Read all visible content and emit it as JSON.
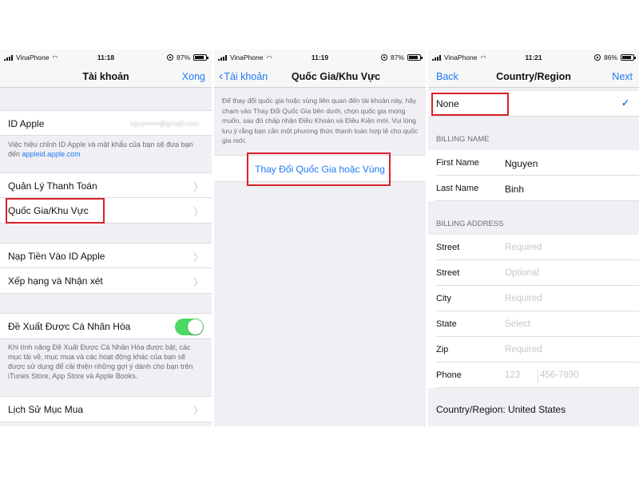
{
  "status_bars": [
    {
      "carrier": "VinaPhone",
      "time": "11:18",
      "battery": "87%",
      "battery_level": 0.87
    },
    {
      "carrier": "VinaPhone",
      "time": "11:19",
      "battery": "87%",
      "battery_level": 0.87
    },
    {
      "carrier": "VinaPhone",
      "time": "11:21",
      "battery": "86%",
      "battery_level": 0.86
    }
  ],
  "screen1": {
    "title": "Tài khoản",
    "done": "Xong",
    "apple_id_label": "ID Apple",
    "apple_id_value": "tqcu••••••@gmail.com",
    "apple_id_footer": "Việc hiệu chỉnh ID Apple và mật khẩu của bạn sẽ đưa bạn đến",
    "apple_id_link": "appleid.apple.com",
    "rows_group1": [
      "Quản Lý Thanh Toán",
      "Quốc Gia/Khu Vực"
    ],
    "rows_group2": [
      "Nạp Tiền Vào ID Apple",
      "Xếp hạng và Nhận xét"
    ],
    "personalized_label": "Đề Xuất Được Cá Nhân Hóa",
    "personalized_on": true,
    "personalized_footer": "Khi tính năng Đề Xuất Được Cá Nhân Hóa được bật, các mục tải về, mục mua và các hoạt động khác của bạn sẽ được sử dụng để cải thiện những gợi ý dành cho bạn trên iTunes Store, App Store và Apple Books.",
    "history_label": "Lịch Sử Mục Mua"
  },
  "screen2": {
    "back": "Tài khoản",
    "title": "Quốc Gia/Khu Vực",
    "info": "Để thay đổi quốc gia hoặc vùng liên quan đến tài khoản này, hãy chạm vào Thay Đổi Quốc Gia bên dưới, chọn quốc gia mong muốn, sau đó chấp nhận Điều Khoản và Điều Kiện mới. Vui lòng lưu ý rằng bạn cần một phương thức thanh toán hợp lệ cho quốc gia mới.",
    "change_button": "Thay Đổi Quốc Gia hoặc Vùng"
  },
  "screen3": {
    "back": "Back",
    "title": "Country/Region",
    "next": "Next",
    "payment_option": "None",
    "billing_name_header": "BILLING NAME",
    "first_name_label": "First Name",
    "first_name_value": "Nguyen",
    "last_name_label": "Last Name",
    "last_name_value": "Binh",
    "billing_address_header": "BILLING ADDRESS",
    "street1_label": "Street",
    "street1_placeholder": "Required",
    "street2_label": "Street",
    "street2_placeholder": "Optional",
    "city_label": "City",
    "city_placeholder": "Required",
    "state_label": "State",
    "state_placeholder": "Select",
    "zip_label": "Zip",
    "zip_placeholder": "Required",
    "phone_label": "Phone",
    "phone_area_placeholder": "123",
    "phone_number_placeholder": "456-7890",
    "country_footer": "Country/Region: United States"
  },
  "colors": {
    "accent": "#1f7af2",
    "highlight_box": "#d9222a",
    "toggle_on": "#4cd964",
    "background": "#efeff4"
  },
  "icons": [
    "signal-icon",
    "wifi-icon",
    "lock-rotation-icon",
    "battery-icon",
    "chevron-right-icon",
    "chevron-left-icon",
    "checkmark-icon"
  ]
}
